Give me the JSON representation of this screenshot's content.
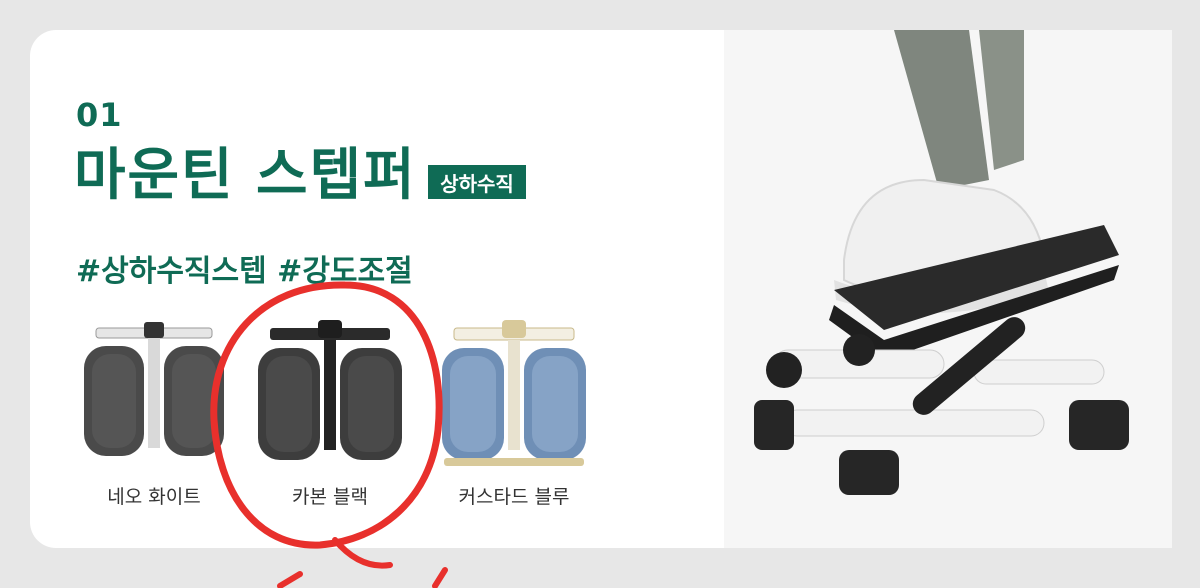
{
  "step_number": "01",
  "product_title": "마운틴 스텝퍼",
  "badge": "상하수직",
  "hashtags": "#상하수직스텝 #강도조절",
  "options": [
    {
      "label": "네오 화이트",
      "frame_color": "#f2f2f2",
      "pad_color": "#4a4a4a",
      "selected": false
    },
    {
      "label": "카본 블랙",
      "frame_color": "#2b2b2b",
      "pad_color": "#3d3d3d",
      "selected": true
    },
    {
      "label": "커스타드 블루",
      "frame_color": "#f3efe2",
      "pad_color": "#6f8fb6",
      "selected": false
    }
  ],
  "colors": {
    "brand_green": "#0f6b55",
    "annotation_red": "#e8302c",
    "background": "#e7e7e7"
  },
  "icons": [
    "stepper-white-image",
    "stepper-black-image",
    "stepper-blue-image",
    "product-photo",
    "hand-drawn-circle",
    "arrow-marks"
  ]
}
